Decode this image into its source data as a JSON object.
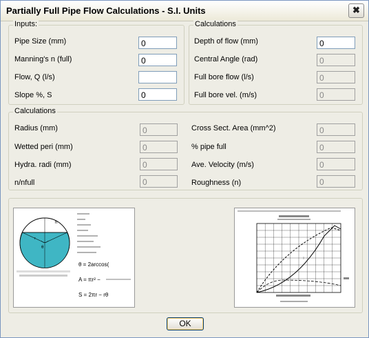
{
  "window": {
    "title": "Partially Full Pipe Flow Calculations - S.I. Units",
    "close_glyph": "✖"
  },
  "inputs": {
    "label": "Inputs:",
    "pipe_size": {
      "label": "Pipe Size (mm)",
      "value": "0"
    },
    "mannings_n": {
      "label": "Manning's n (full)",
      "value": "0"
    },
    "flow": {
      "label": "Flow, Q (l/s)",
      "value": ""
    },
    "slope": {
      "label": "Slope %, S",
      "value": "0"
    }
  },
  "calc_top": {
    "label": "Calculations",
    "depth": {
      "label": "Depth of flow (mm)",
      "value": "0"
    },
    "central_angle": {
      "label": "Central Angle (rad)",
      "value": "0"
    },
    "full_bore_flow": {
      "label": "Full bore flow (l/s)",
      "value": "0"
    },
    "full_bore_vel": {
      "label": "Full bore vel. (m/s)",
      "value": "0"
    }
  },
  "calc_bottom": {
    "label": "Calculations",
    "radius": {
      "label": "Radius (mm)",
      "value": "0"
    },
    "wetted_peri": {
      "label": "Wetted peri (mm)",
      "value": "0"
    },
    "hydra_radi": {
      "label": "Hydra. radi (mm)",
      "value": "0"
    },
    "n_nfull": {
      "label": "n/nfull",
      "value": "0"
    },
    "cross_sect": {
      "label": "Cross Sect. Area (mm^2)",
      "value": "0"
    },
    "pipe_full": {
      "label": "% pipe full",
      "value": "0"
    },
    "ave_velocity": {
      "label": "Ave. Velocity (m/s)",
      "value": "0"
    },
    "roughness": {
      "label": "Roughness (n)",
      "value": "0"
    }
  },
  "ok_button": {
    "label": "OK"
  },
  "colors": {
    "accent": "#003c74",
    "pipe_fill": "#3fb6c4"
  }
}
